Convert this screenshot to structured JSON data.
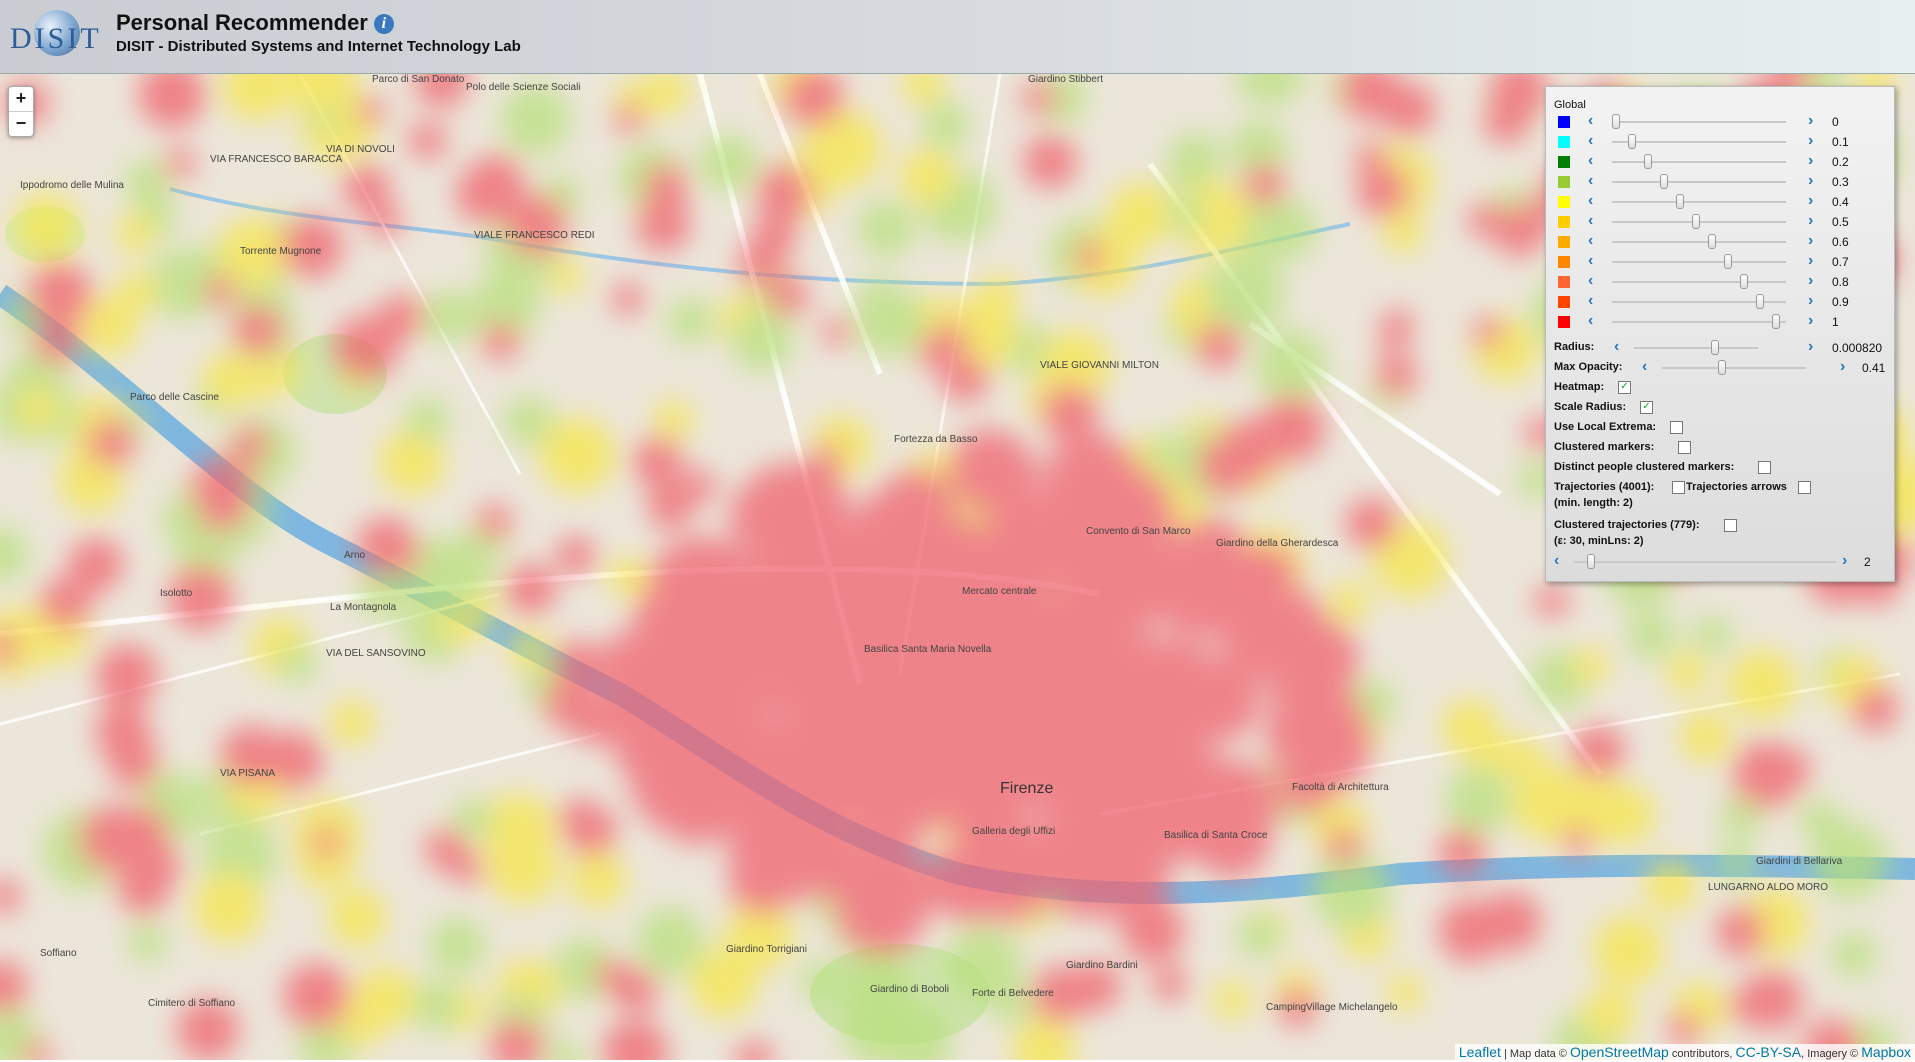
{
  "header": {
    "logo_text": "DISIT",
    "title": "Personal Recommender",
    "info_icon": "i",
    "subtitle": "DISIT - Distributed Systems and Internet Technology Lab"
  },
  "zoom": {
    "in": "+",
    "out": "−"
  },
  "panel": {
    "title": "Global",
    "gradient": [
      {
        "color": "#0000ff",
        "value": "0",
        "level": 0.0
      },
      {
        "color": "#00ffff",
        "value": "0.1",
        "level": 0.1
      },
      {
        "color": "#008000",
        "value": "0.2",
        "level": 0.2
      },
      {
        "color": "#99cc33",
        "value": "0.3",
        "level": 0.3
      },
      {
        "color": "#ffff00",
        "value": "0.4",
        "level": 0.4
      },
      {
        "color": "#ffcc00",
        "value": "0.5",
        "level": 0.5
      },
      {
        "color": "#ffaa00",
        "value": "0.6",
        "level": 0.6
      },
      {
        "color": "#ff8800",
        "value": "0.7",
        "level": 0.7
      },
      {
        "color": "#ff6633",
        "value": "0.8",
        "level": 0.8
      },
      {
        "color": "#ff4400",
        "value": "0.9",
        "level": 0.9
      },
      {
        "color": "#ff0000",
        "value": "1",
        "level": 1.0
      }
    ],
    "radius": {
      "label": "Radius:",
      "value": "0.000820",
      "level": 0.66
    },
    "max_opacity": {
      "label": "Max Opacity:",
      "value": "0.41",
      "level": 0.41
    },
    "checks": [
      {
        "label": "Heatmap:",
        "checked": true
      },
      {
        "label": "Scale Radius:",
        "checked": true
      },
      {
        "label": "Use Local Extrema:",
        "checked": false
      },
      {
        "label": "Clustered markers:",
        "checked": false
      },
      {
        "label": "Distinct people clustered markers:",
        "checked": false
      }
    ],
    "trajectories": {
      "label": "Trajectories (4001):",
      "arrows_label": "Trajectories arrows",
      "min_length": "(min. length: 2)"
    },
    "clustered_trajectories": {
      "label": "Clustered trajectories (779):",
      "params": "(ε: 30, minLns: 2)",
      "value": "2",
      "level": 0.05
    }
  },
  "map_labels": [
    "Polo delle Scienze Sociali",
    "Parco di San Donato",
    "Giardino Stibbert",
    "VIA DI NOVOLI",
    "VIA FRANCESCO BARACCA",
    "VIALE FRANCESCO REDI",
    "Ippodromo delle Mulina",
    "Parco delle Cascine",
    "Fortezza da Basso",
    "Mercato centrale",
    "Basilica Santa Maria Novella",
    "Convento di San Marco",
    "Giardino della Gherardesca",
    "Firenze",
    "Galleria degli Uffizi",
    "Basilica di Santa Croce",
    "Facoltà di Architettura",
    "Giardino di Boboli",
    "Forte di Belvedere",
    "Giardino Bardini",
    "Giardino Torrigiani",
    "Isolotto",
    "La Montagnola",
    "Soffiano",
    "Cimitero di Soffiano",
    "CampingVillage Michelangelo",
    "Giardini di Bellariva",
    "Torrente Mugnone",
    "Arno",
    "VIA PISANA",
    "VIA DEL SANSOVINO",
    "LUNGARNO ALDO MORO",
    "VIALE GIOVANNI MILTON"
  ],
  "attribution": {
    "leaflet": "Leaflet",
    "map_data": "| Map data ©",
    "osm": "OpenStreetMap",
    "contributors": "contributors,",
    "license": "CC-BY-SA",
    "imagery": ", Imagery ©",
    "mapbox": "Mapbox"
  }
}
